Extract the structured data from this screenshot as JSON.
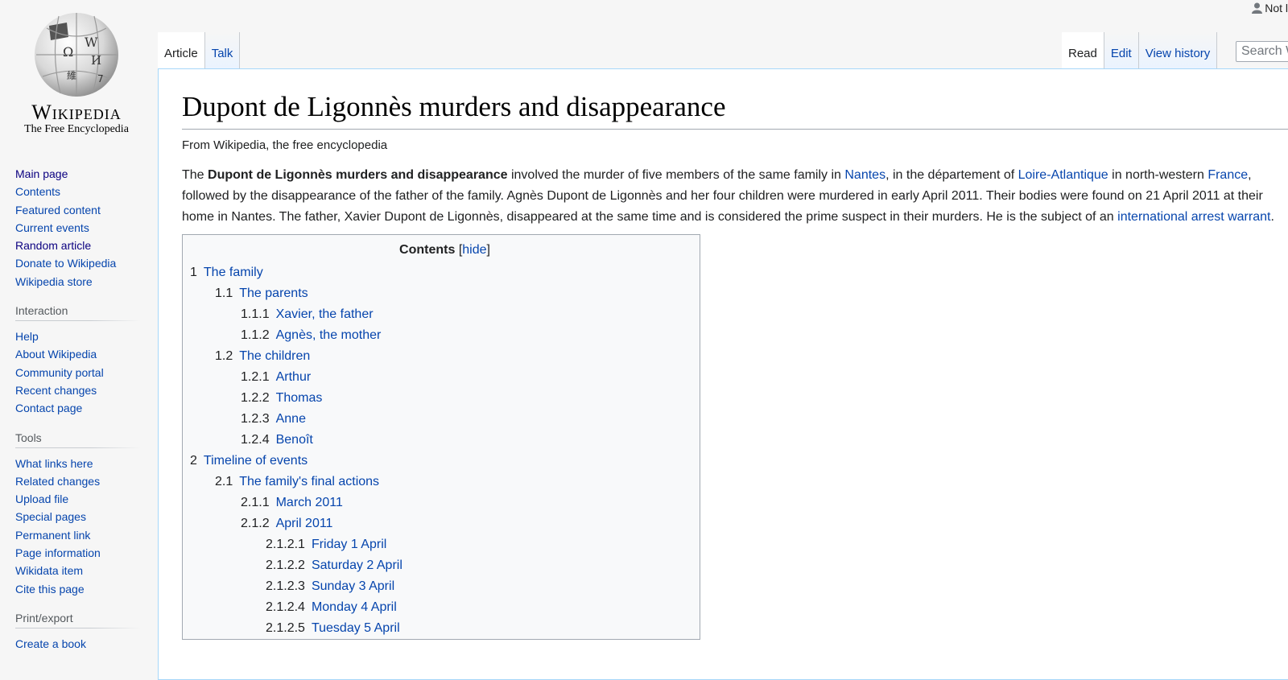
{
  "personal": {
    "label": "Not l"
  },
  "logo": {
    "wordmark": "Wikipedia",
    "tagline": "The Free Encyclopedia"
  },
  "sidebar": {
    "navigation": [
      "Main page",
      "Contents",
      "Featured content",
      "Current events",
      "Random article",
      "Donate to Wikipedia",
      "Wikipedia store"
    ],
    "interaction": {
      "heading": "Interaction",
      "items": [
        "Help",
        "About Wikipedia",
        "Community portal",
        "Recent changes",
        "Contact page"
      ]
    },
    "tools": {
      "heading": "Tools",
      "items": [
        "What links here",
        "Related changes",
        "Upload file",
        "Special pages",
        "Permanent link",
        "Page information",
        "Wikidata item",
        "Cite this page"
      ]
    },
    "print": {
      "heading": "Print/export",
      "items": [
        "Create a book"
      ]
    }
  },
  "tabs": {
    "left": [
      "Article",
      "Talk"
    ],
    "right": [
      "Read",
      "Edit",
      "View history"
    ]
  },
  "search": {
    "placeholder": "Search W"
  },
  "article": {
    "title": "Dupont de Ligonnès murders and disappearance",
    "site_sub": "From Wikipedia, the free encyclopedia",
    "lead": {
      "t1": "The ",
      "bold": "Dupont de Ligonnès murders and disappearance",
      "t2": " involved the murder of five members of the same family in ",
      "link_nantes": "Nantes",
      "t3": ", in the département of ",
      "link_loire": "Loire-Atlantique",
      "t4": " in north-western ",
      "link_france": "France",
      "t5": ", followed by the disappearance of the father of the family. Agnès Dupont de Ligonnès and her four children were murdered in early April 2011. Their bodies were found on 21 April 2011 at their home in Nantes. The father, Xavier Dupont de Ligonnès, disappeared at the same time and is considered the prime suspect in their murders. He is the subject of an ",
      "link_warrant": "international arrest warrant",
      "t6": "."
    }
  },
  "toc": {
    "title": "Contents",
    "hide": "hide",
    "bracket_open": "[",
    "bracket_close": "]",
    "items": [
      {
        "num": "1",
        "label": "The family",
        "level": 1
      },
      {
        "num": "1.1",
        "label": "The parents",
        "level": 2
      },
      {
        "num": "1.1.1",
        "label": "Xavier, the father",
        "level": 3
      },
      {
        "num": "1.1.2",
        "label": "Agnès, the mother",
        "level": 3
      },
      {
        "num": "1.2",
        "label": "The children",
        "level": 2
      },
      {
        "num": "1.2.1",
        "label": "Arthur",
        "level": 3
      },
      {
        "num": "1.2.2",
        "label": "Thomas",
        "level": 3
      },
      {
        "num": "1.2.3",
        "label": "Anne",
        "level": 3
      },
      {
        "num": "1.2.4",
        "label": "Benoît",
        "level": 3
      },
      {
        "num": "2",
        "label": "Timeline of events",
        "level": 1
      },
      {
        "num": "2.1",
        "label": "The family's final actions",
        "level": 2
      },
      {
        "num": "2.1.1",
        "label": "March 2011",
        "level": 3
      },
      {
        "num": "2.1.2",
        "label": "April 2011",
        "level": 3
      },
      {
        "num": "2.1.2.1",
        "label": "Friday 1 April",
        "level": 4
      },
      {
        "num": "2.1.2.2",
        "label": "Saturday 2 April",
        "level": 4
      },
      {
        "num": "2.1.2.3",
        "label": "Sunday 3 April",
        "level": 4
      },
      {
        "num": "2.1.2.4",
        "label": "Monday 4 April",
        "level": 4
      },
      {
        "num": "2.1.2.5",
        "label": "Tuesday 5 April",
        "level": 4
      }
    ]
  },
  "colors": {
    "link": "#0645ad",
    "visited_nav": "#0b0080",
    "border": "#a7d7f9",
    "toc_bg": "#f8f9fa"
  },
  "icons": {
    "user": "user-icon",
    "logo": "wikipedia-globe-icon"
  }
}
